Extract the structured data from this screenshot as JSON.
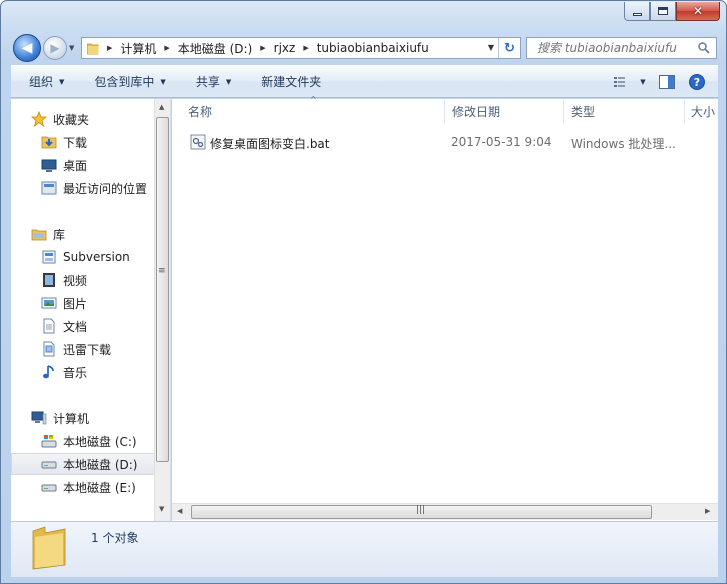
{
  "window": {
    "title": ""
  },
  "address": {
    "crumbs": [
      "计算机",
      "本地磁盘 (D:)",
      "rjxz",
      "tubiaobianbaixiufu"
    ]
  },
  "search": {
    "placeholder": "搜索 tubiaobianbaixiufu"
  },
  "toolbar": {
    "organize": "组织",
    "include_in_library": "包含到库中",
    "share": "共享",
    "new_folder": "新建文件夹"
  },
  "sidebar": {
    "favorites": {
      "label": "收藏夹",
      "items": [
        {
          "label": "下载",
          "icon": "download-folder-icon"
        },
        {
          "label": "桌面",
          "icon": "desktop-icon"
        },
        {
          "label": "最近访问的位置",
          "icon": "recent-places-icon"
        }
      ]
    },
    "libraries": {
      "label": "库",
      "items": [
        {
          "label": "Subversion",
          "icon": "subversion-icon"
        },
        {
          "label": "视频",
          "icon": "video-icon"
        },
        {
          "label": "图片",
          "icon": "pictures-icon"
        },
        {
          "label": "文档",
          "icon": "documents-icon"
        },
        {
          "label": "迅雷下载",
          "icon": "thunder-download-icon"
        },
        {
          "label": "音乐",
          "icon": "music-icon"
        }
      ]
    },
    "computer": {
      "label": "计算机",
      "items": [
        {
          "label": "本地磁盘 (C:)",
          "icon": "system-drive-icon"
        },
        {
          "label": "本地磁盘 (D:)",
          "icon": "drive-icon",
          "selected": true
        },
        {
          "label": "本地磁盘 (E:)",
          "icon": "drive-icon"
        }
      ]
    }
  },
  "columns": [
    "名称",
    "修改日期",
    "类型",
    "大小"
  ],
  "files": [
    {
      "name": "修复桌面图标变白.bat",
      "modified": "2017-05-31 9:04",
      "type": "Windows 批处理...",
      "icon": "batch-file-icon"
    }
  ],
  "details": {
    "count": "1 个对象"
  },
  "colors": {
    "accent": "#3d7fd6",
    "text_link": "#1e395b",
    "frame": "#bcd2ec"
  }
}
